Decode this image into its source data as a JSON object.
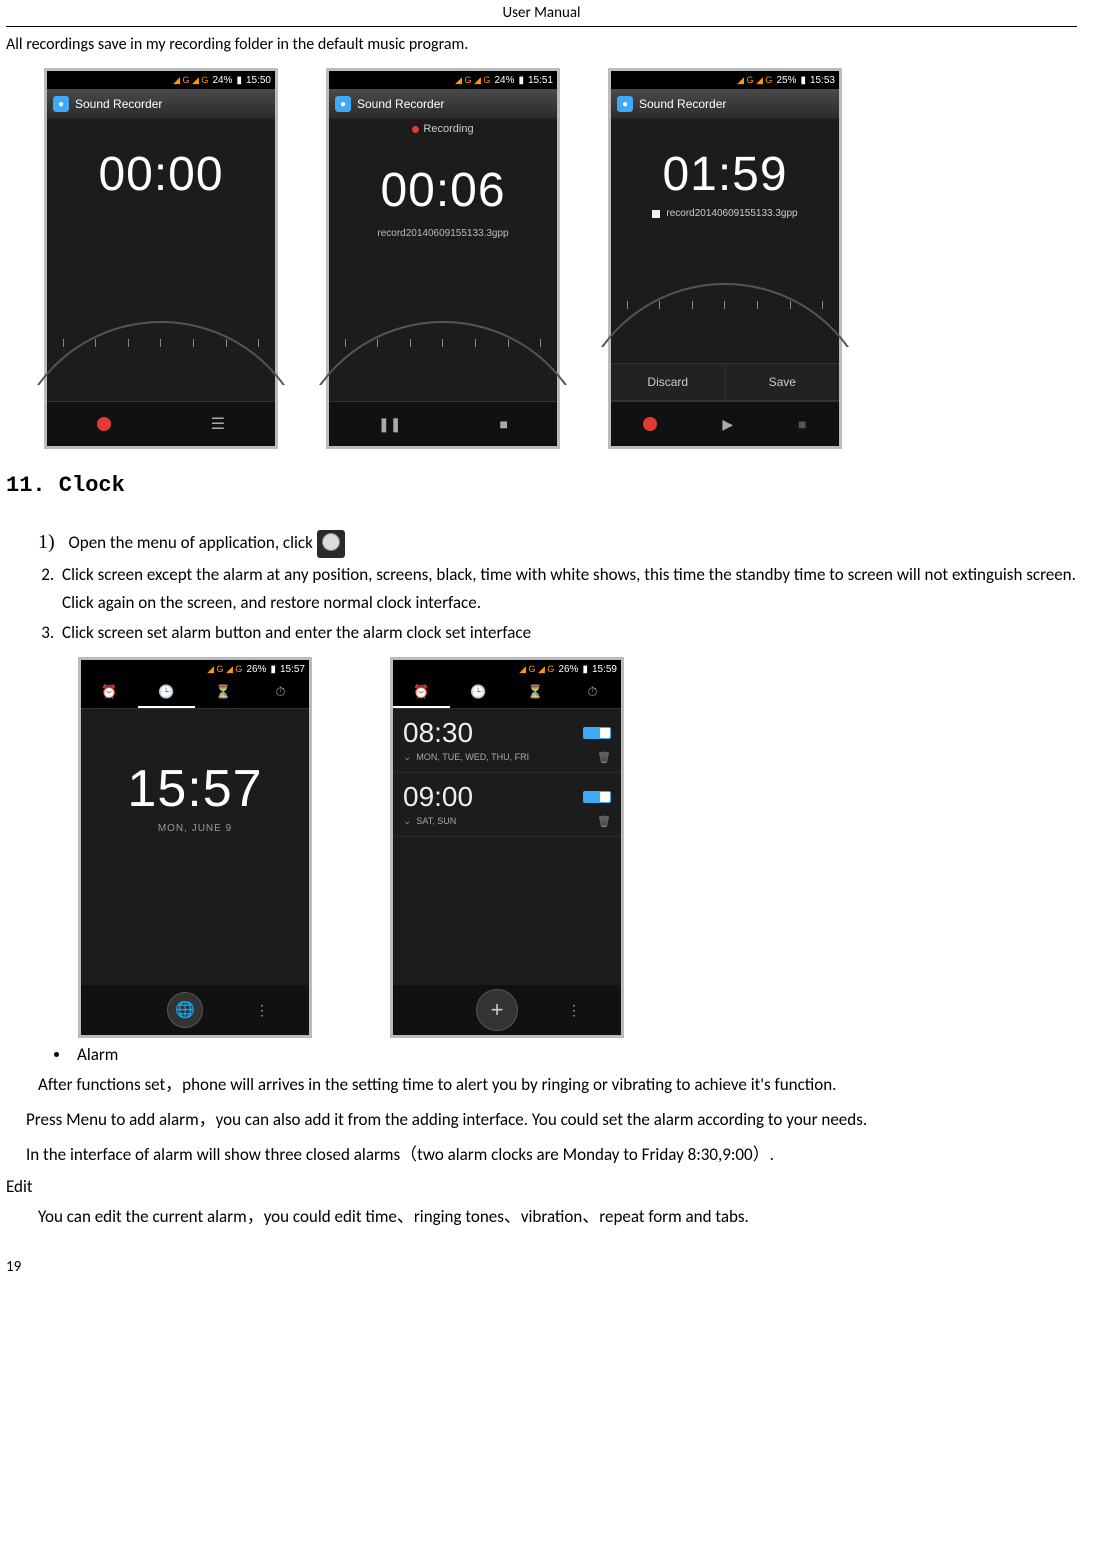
{
  "header": "User    Manual",
  "intro": "All recordings save in my recording folder in the default music program.",
  "recorder": {
    "app_title": "Sound Recorder",
    "shot1": {
      "battery": "24%",
      "clock": "15:50",
      "time": "00:00"
    },
    "shot2": {
      "battery": "24%",
      "clock": "15:51",
      "time": "00:06",
      "status": "Recording",
      "file": "record20140609155133.3gpp"
    },
    "shot3": {
      "battery": "25%",
      "clock": "15:53",
      "time": "01:59",
      "file": "record20140609155133.3gpp",
      "discard": "Discard",
      "save": "Save"
    }
  },
  "section_heading": "11. Clock",
  "steps": {
    "s1": "Open the menu of application, click",
    "s2": "Click screen except the alarm at any position, screens, black, time with white shows, this time the standby time to screen will not extinguish screen. Click again on the screen, and restore normal clock interface.",
    "s3": "Click screen set alarm button and enter the alarm clock set interface"
  },
  "clock_shots": {
    "s1": {
      "battery": "26%",
      "clock": "15:57",
      "time": "15:57",
      "date": "MON, JUNE 9"
    },
    "s2": {
      "battery": "26%",
      "clock": "15:59",
      "alarm1": {
        "time": "08:30",
        "days": "MON, TUE, WED, THU, FRI"
      },
      "alarm2": {
        "time": "09:00",
        "days": "SAT, SUN"
      }
    }
  },
  "alarm_bullet": "Alarm",
  "para1": "After functions set，phone will arrives in the setting time to alert you by ringing or vibrating to achieve it's function.",
  "para2": "Press Menu to add alarm，you can also add it from the adding interface. You could set the alarm according to your needs.",
  "para3": "In the interface of alarm will show three closed alarms（two alarm clocks are Monday to Friday 8:30,9:00）.",
  "edit_label": "Edit",
  "para4": "You can edit the current alarm，you could edit time、ringing tones、vibration、repeat form and tabs.",
  "page_number": "19"
}
